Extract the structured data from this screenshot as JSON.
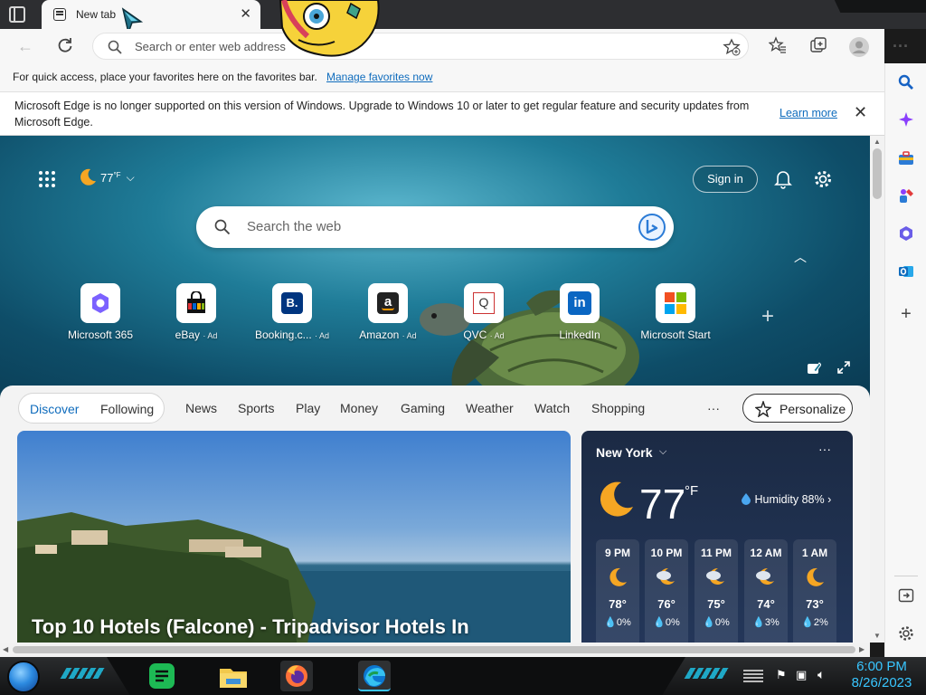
{
  "browser": {
    "tab": {
      "title": "New tab"
    },
    "address_bar": {
      "placeholder": "Search or enter web address"
    },
    "favorites_bar": {
      "text": "For quick access, place your favorites here on the favorites bar.",
      "link": "Manage favorites now"
    },
    "info_bar": {
      "message": "Microsoft Edge is no longer supported on this version of Windows. Upgrade to Windows 10 or later to get regular feature and security updates from Microsoft Edge.",
      "link": "Learn more"
    }
  },
  "newtab": {
    "weather_chip": "77",
    "weather_chip_unit": "°F",
    "signin_label": "Sign in",
    "search_placeholder": "Search the web",
    "quick_links": [
      {
        "label": "Microsoft 365",
        "ad": ""
      },
      {
        "label": "eBay",
        "ad": "· Ad"
      },
      {
        "label": "Booking.c...",
        "ad": "· Ad"
      },
      {
        "label": "Amazon",
        "ad": "· Ad"
      },
      {
        "label": "QVC",
        "ad": "· Ad"
      },
      {
        "label": "LinkedIn",
        "ad": ""
      },
      {
        "label": "Microsoft Start",
        "ad": ""
      }
    ],
    "feed_pill": {
      "discover": "Discover",
      "following": "Following"
    },
    "feed_tabs": [
      "News",
      "Sports",
      "Play",
      "Money",
      "Gaming",
      "Weather",
      "Watch",
      "Shopping"
    ],
    "more_label": "···",
    "personalize_label": "Personalize",
    "article": {
      "headline": "Top 10 Hotels (Falcone) - Tripadvisor Hotels In"
    },
    "weather": {
      "city": "New York",
      "dots": "···",
      "temp": "77",
      "unit": "°F",
      "humidity": "Humidity 88%",
      "hourly": [
        {
          "hour": "9 PM",
          "temp": "78°",
          "precip": "0%",
          "icon": "moon-icon"
        },
        {
          "hour": "10 PM",
          "temp": "76°",
          "precip": "0%",
          "icon": "cloudy-moon-icon"
        },
        {
          "hour": "11 PM",
          "temp": "75°",
          "precip": "0%",
          "icon": "cloudy-moon-icon"
        },
        {
          "hour": "12 AM",
          "temp": "74°",
          "precip": "3%",
          "icon": "cloudy-moon-icon"
        },
        {
          "hour": "1 AM",
          "temp": "73°",
          "precip": "2%",
          "icon": "moon-icon"
        }
      ]
    }
  },
  "taskbar": {
    "time": "6:00 PM",
    "date": "8/26/2023"
  },
  "colors": {
    "accent": "#0f6cbd",
    "hero": "#1f7c98",
    "clock": "#39c6ff"
  }
}
